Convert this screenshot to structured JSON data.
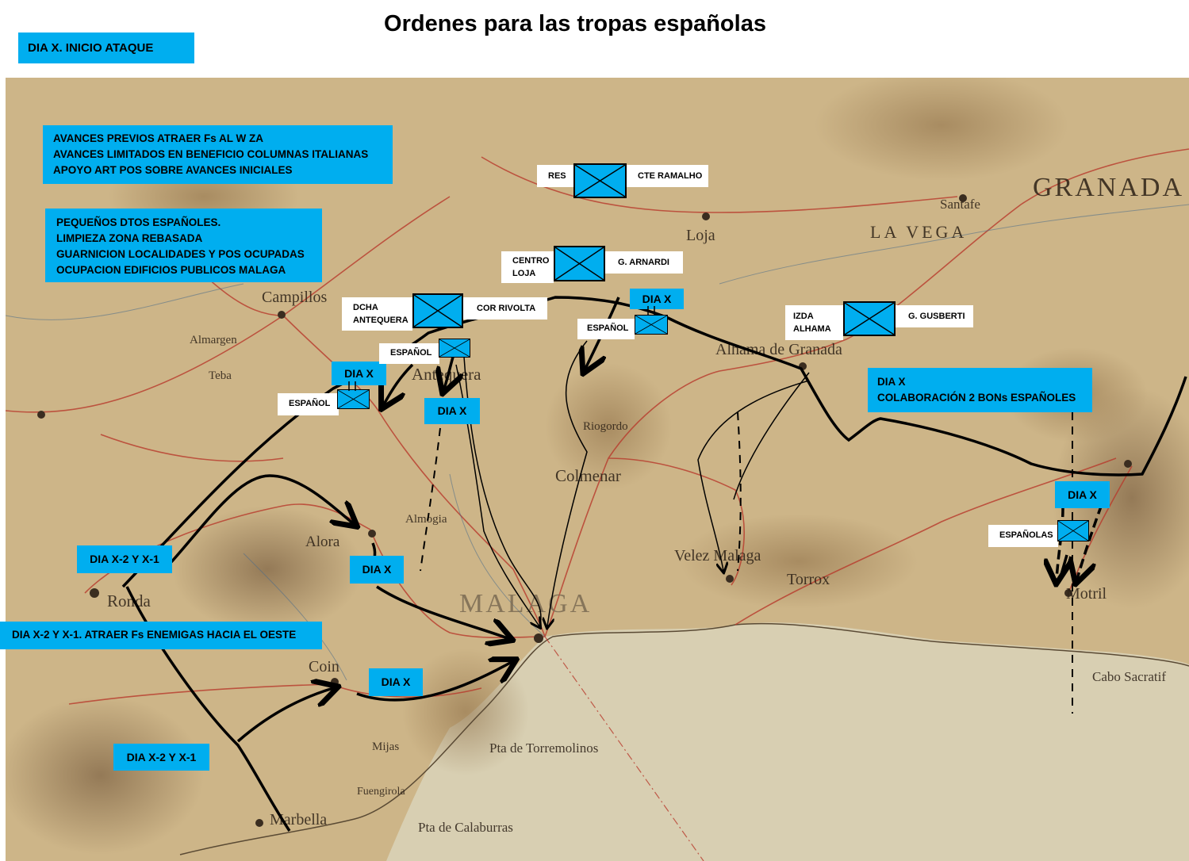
{
  "title": "Ordenes para las tropas españolas",
  "header_box": "DIA X. INICIO ATAQUE",
  "notes": {
    "avances": [
      "AVANCES PREVIOS ATRAER Fs AL W ZA",
      "AVANCES LIMITADOS EN BENEFICIO COLUMNAS ITALIANAS",
      "APOYO ART POS SOBRE AVANCES INICIALES"
    ],
    "pequenos": [
      "PEQUEÑOS DTOS ESPAÑOLES.",
      "LIMPIEZA ZONA REBASADA",
      "GUARNICION LOCALIDADES Y POS OCUPADAS",
      "OCUPACION EDIFICIOS PUBLICOS MALAGA"
    ],
    "colaboracion": [
      "DIA X",
      "COLABORACIÓN  2 BONs ESPAÑOLES"
    ],
    "oeste": "DIA X-2 Y X-1. ATRAER Fs ENEMIGAS HACIA EL OESTE"
  },
  "phase_labels": {
    "dia_x": "DIA X",
    "dia_x2_x1": "DIA X-2 Y X-1"
  },
  "units": {
    "res": {
      "left": "RES",
      "right": "CTE RAMALHO"
    },
    "loja": {
      "left": [
        "CENTRO",
        "LOJA"
      ],
      "right": "G. ARNARDI"
    },
    "antequera": {
      "left": [
        "DCHA",
        "ANTEQUERA"
      ],
      "right": "COR RIVOLTA"
    },
    "alhama": {
      "left": [
        "IZDA",
        "ALHAMA"
      ],
      "right": "G. GUSBERTI"
    },
    "espanol": "ESPAÑOL",
    "espanolas": "ESPAÑOLAS"
  },
  "places": {
    "granada": "GRANADA",
    "malaga": "MALAGA",
    "loja": "Loja",
    "antequera": "Antequera",
    "alhama": "Alhama de Granada",
    "ronda": "Ronda",
    "marbella": "Marbella",
    "motril": "Motril",
    "velez": "Velez Malaga",
    "colmenar": "Colmenar",
    "alora": "Alora",
    "coin": "Coin",
    "torrox": "Torrox",
    "campillos": "Campillos",
    "santafe": "Santafe",
    "la_vega": "LA VEGA",
    "mijas": "Mijas",
    "fuengirola": "Fuengirola",
    "torremolinos": "Pta de Torremolinos",
    "calaburras": "Pta de Calaburras",
    "teba": "Teba",
    "almargen": "Almargen",
    "almogia": "Almogia",
    "riogordo": "Riogordo",
    "cabo_sacratif": "Cabo Sacratif"
  },
  "colors": {
    "box_blue": "#00aeef",
    "map_base": "#c9b184",
    "sea": "#d9d2b8",
    "road": "#b83a2c"
  }
}
